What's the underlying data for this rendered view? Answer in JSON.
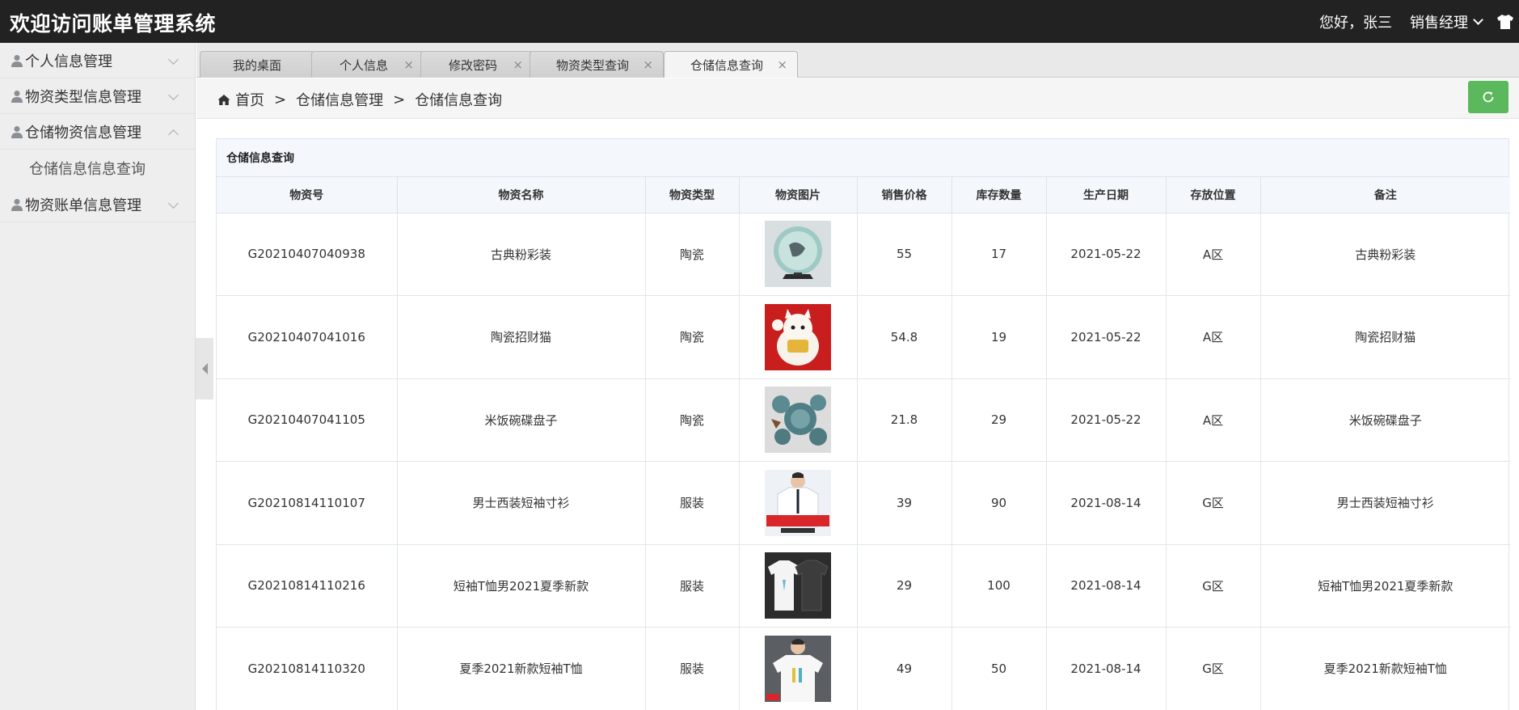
{
  "header": {
    "title": "欢迎访问账单管理系统",
    "greeting": "您好，张三",
    "role": "销售经理",
    "shirt_icon": "shirt-icon"
  },
  "sidebar": {
    "items": [
      {
        "label": "个人信息管理",
        "expanded": false
      },
      {
        "label": "物资类型信息管理",
        "expanded": false
      },
      {
        "label": "仓储物资信息管理",
        "expanded": true,
        "children": [
          "仓储信息信息查询"
        ]
      },
      {
        "label": "物资账单信息管理",
        "expanded": false
      }
    ]
  },
  "tabs": [
    {
      "label": "我的桌面",
      "closable": false
    },
    {
      "label": "个人信息",
      "closable": true
    },
    {
      "label": "修改密码",
      "closable": true
    },
    {
      "label": "物资类型查询",
      "closable": true
    },
    {
      "label": "仓储信息查询",
      "closable": true,
      "active": true
    }
  ],
  "tab_close_glyph": "×",
  "breadcrumb": {
    "home": "首页",
    "separator": ">",
    "level1": "仓储信息管理",
    "level2": "仓储信息查询"
  },
  "panel": {
    "title": "仓储信息查询",
    "columns": [
      "物资号",
      "物资名称",
      "物资类型",
      "物资图片",
      "销售价格",
      "库存数量",
      "生产日期",
      "存放位置",
      "备注"
    ],
    "rows": [
      {
        "id": "G20210407040938",
        "name": "古典粉彩装",
        "type": "陶瓷",
        "image": "ceramic-plate-image",
        "price": "55",
        "stock": "17",
        "date": "2021-05-22",
        "location": "A区",
        "note": "古典粉彩装"
      },
      {
        "id": "G20210407041016",
        "name": "陶瓷招财猫",
        "type": "陶瓷",
        "image": "lucky-cat-image",
        "price": "54.8",
        "stock": "19",
        "date": "2021-05-22",
        "location": "A区",
        "note": "陶瓷招财猫"
      },
      {
        "id": "G20210407041105",
        "name": "米饭碗碟盘子",
        "type": "陶瓷",
        "image": "bowl-set-image",
        "price": "21.8",
        "stock": "29",
        "date": "2021-05-22",
        "location": "A区",
        "note": "米饭碗碟盘子"
      },
      {
        "id": "G20210814110107",
        "name": "男士西装短袖寸衫",
        "type": "服装",
        "image": "dress-shirt-image",
        "price": "39",
        "stock": "90",
        "date": "2021-08-14",
        "location": "G区",
        "note": "男士西装短袖寸衫"
      },
      {
        "id": "G20210814110216",
        "name": "短袖T恤男2021夏季新款",
        "type": "服装",
        "image": "tshirt-pair-image",
        "price": "29",
        "stock": "100",
        "date": "2021-08-14",
        "location": "G区",
        "note": "短袖T恤男2021夏季新款"
      },
      {
        "id": "G20210814110320",
        "name": "夏季2021新款短袖T恤",
        "type": "服装",
        "image": "tshirt-model-image",
        "price": "49",
        "stock": "50",
        "date": "2021-08-14",
        "location": "G区",
        "note": "夏季2021新款短袖T恤"
      }
    ]
  },
  "colors": {
    "header_bg": "#222222",
    "sidebar_bg": "#eeeeee",
    "refresh_button": "#5cb85c",
    "table_header_bg": "#f4f8fc"
  }
}
